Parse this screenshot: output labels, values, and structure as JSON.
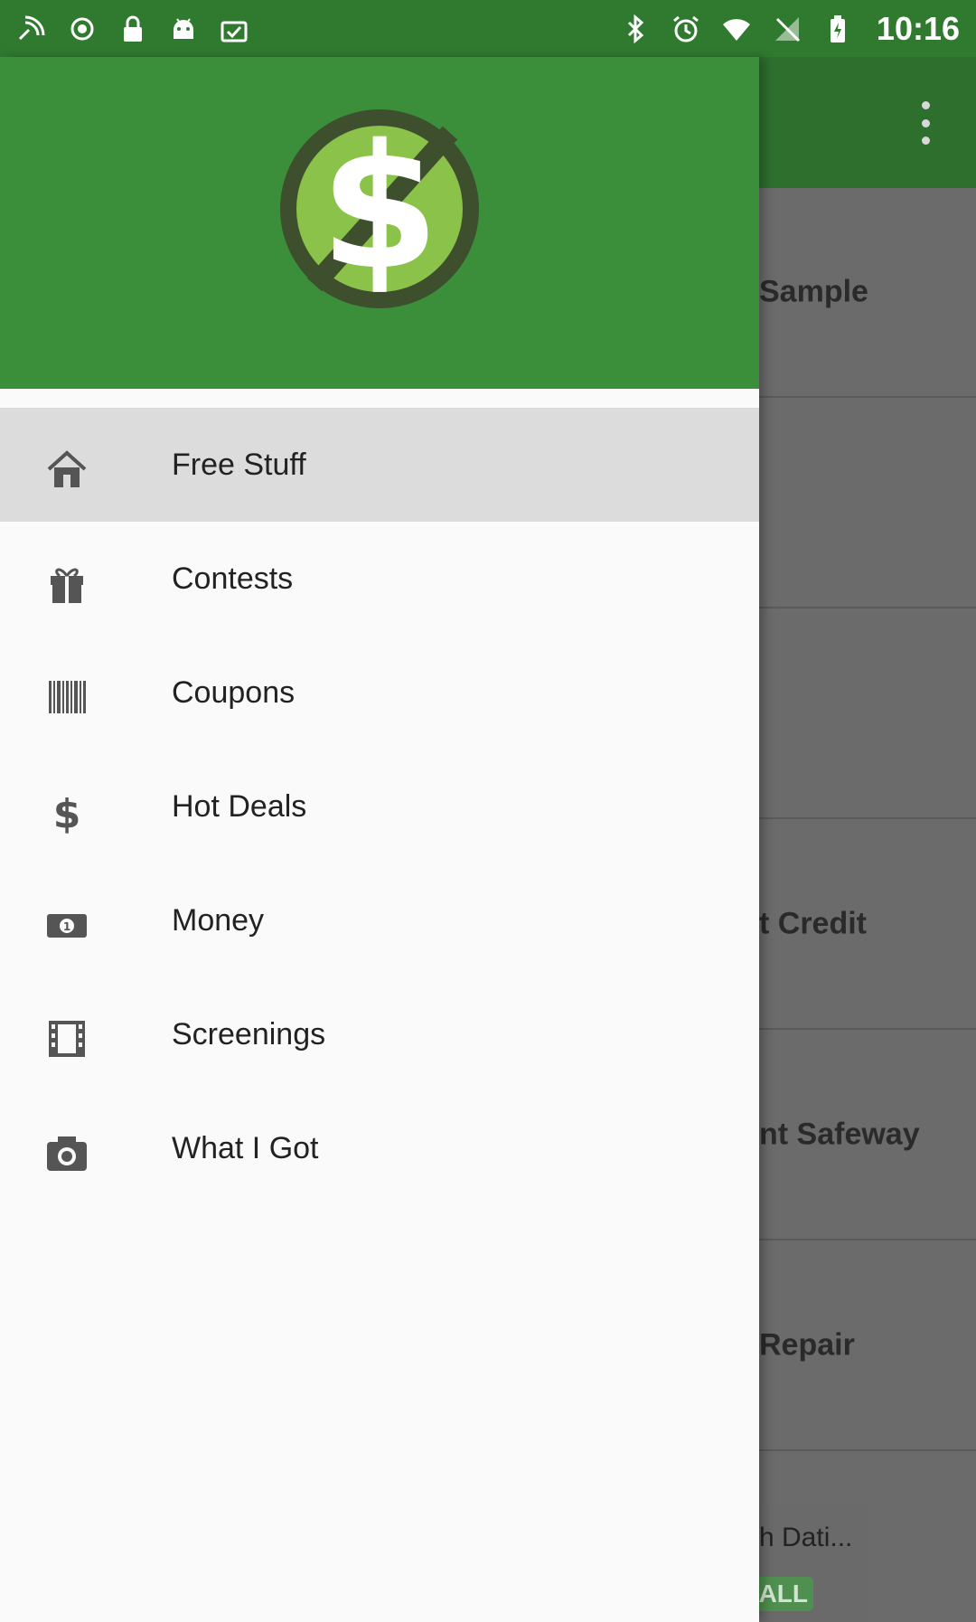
{
  "status_bar": {
    "time": "10:16",
    "left_icons": [
      "signal-wave-icon",
      "wifi-calling-icon",
      "lock-icon",
      "android-icon",
      "clipboard-check-icon"
    ],
    "right_icons": [
      "bluetooth-icon",
      "alarm-icon",
      "wifi-icon",
      "no-signal-icon",
      "battery-icon"
    ]
  },
  "background": {
    "list_items": [
      "Sample",
      "",
      "",
      "t Credit",
      "nt Safeway",
      "Repair"
    ],
    "ad": {
      "title": "h Dati...",
      "button": "ALL"
    }
  },
  "drawer": {
    "menu": [
      {
        "label": "Free Stuff",
        "icon": "home-icon"
      },
      {
        "label": "Contests",
        "icon": "gift-icon"
      },
      {
        "label": "Coupons",
        "icon": "barcode-icon"
      },
      {
        "label": "Hot Deals",
        "icon": "dollar-icon"
      },
      {
        "label": "Money",
        "icon": "cash-icon"
      },
      {
        "label": "Screenings",
        "icon": "film-icon"
      },
      {
        "label": "What I Got",
        "icon": "camera-icon"
      }
    ],
    "active_index": 0
  },
  "colors": {
    "status_bar": "#2f7a2f",
    "drawer_header": "#3b8f3b",
    "toolbar": "#2e6f2e",
    "logo_inner": "#8bc34a",
    "logo_ring": "#3e4f2e"
  }
}
